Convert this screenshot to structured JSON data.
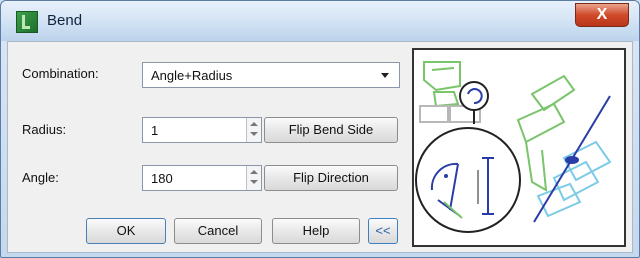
{
  "window": {
    "title": "Bend",
    "close_label": "X"
  },
  "form": {
    "combination": {
      "label": "Combination:",
      "value": "Angle+Radius"
    },
    "radius": {
      "label": "Radius:",
      "value": "1"
    },
    "angle": {
      "label": "Angle:",
      "value": "180"
    }
  },
  "buttons": {
    "flip_bend_side": "Flip Bend Side",
    "flip_direction": "Flip Direction",
    "ok": "OK",
    "cancel": "Cancel",
    "help": "Help",
    "collapse": "<<"
  },
  "colors": {
    "preview_green": "#7ac46a",
    "preview_cyan": "#7ccbe6",
    "preview_blue": "#2a3ca8"
  }
}
